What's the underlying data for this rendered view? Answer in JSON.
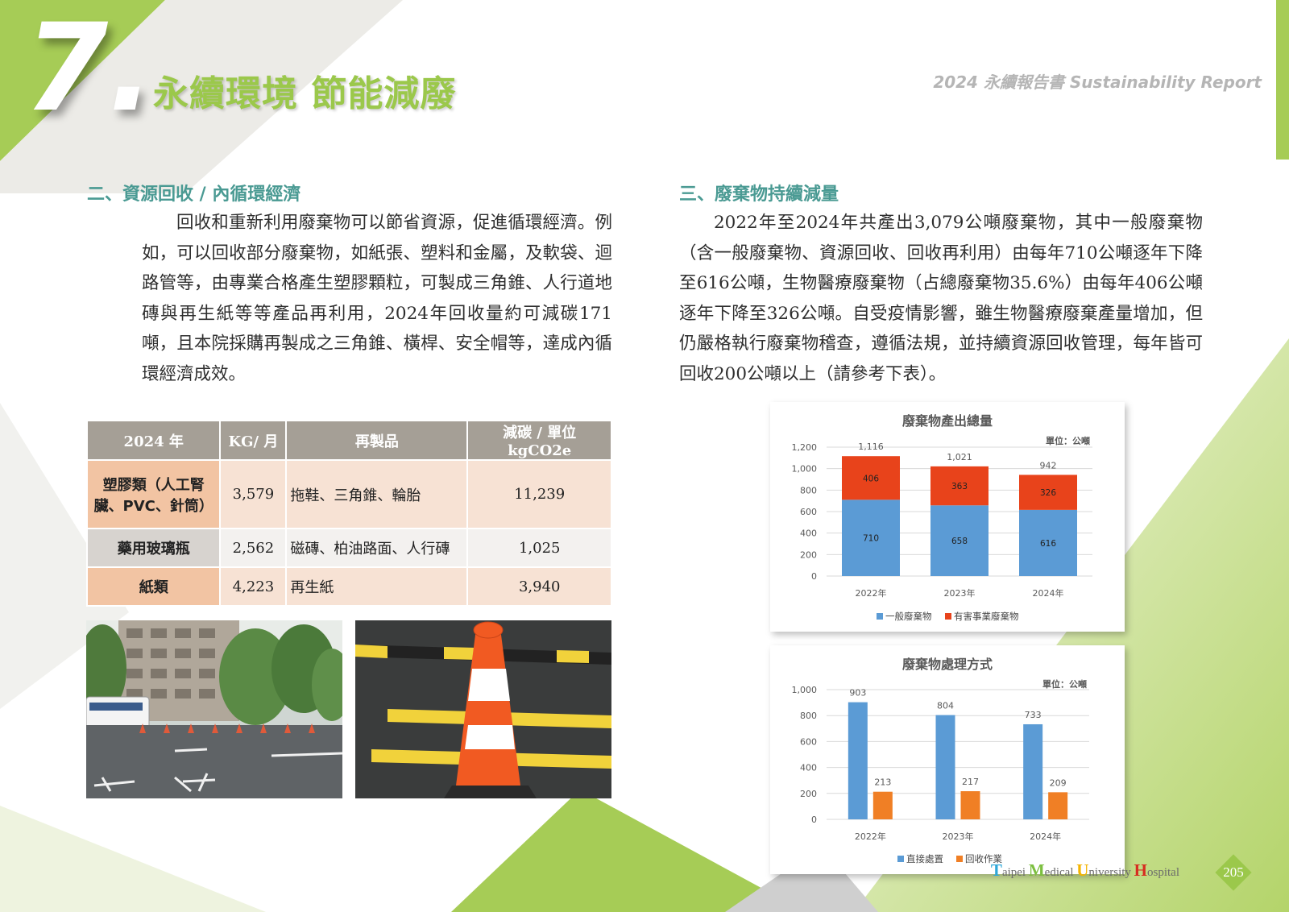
{
  "header": {
    "chapter_number": "7.",
    "chapter_title": "永續環境 節能減廢",
    "report_tag": "2024 永續報告書 Sustainability Report"
  },
  "left_section": {
    "heading": "二、資源回收 / 內循環經濟",
    "paragraph": "回收和重新利用廢棄物可以節省資源，促進循環經濟。例如，可以回收部分廢棄物，如紙張、塑料和金屬，及軟袋、迴路管等，由專業合格產生塑膠顆粒，可製成三角錐、人行道地磚與再生紙等等產品再利用，2024年回收量約可減碳171噸，且本院採購再製成之三角錐、橫桿、安全帽等，達成內循環經濟成效。"
  },
  "table": {
    "headers": [
      "2024 年",
      "KG/ 月",
      "再製品",
      "減碳 / 單位 kgCO2e"
    ],
    "rows": [
      {
        "category": "塑膠類（人工腎臟、PVC、針筒）",
        "kg": "3,579",
        "product": "拖鞋、三角錐、輪胎",
        "reduction": "11,239"
      },
      {
        "category": "藥用玻璃瓶",
        "kg": "2,562",
        "product": "磁磚、柏油路面、人行磚",
        "reduction": "1,025"
      },
      {
        "category": "紙類",
        "kg": "4,223",
        "product": "再生紙",
        "reduction": "3,940"
      }
    ]
  },
  "right_section": {
    "heading": "三、廢棄物持續減量",
    "paragraph": "2022年至2024年共產出3,079公噸廢棄物，其中一般廢棄物（含一般廢棄物、資源回收、回收再利用）由每年710公噸逐年下降至616公噸，生物醫療廢棄物（占總廢棄物35.6%）由每年406公噸逐年下降至326公噸。自受疫情影響，雖生物醫療廢棄產量增加，但仍嚴格執行廢棄物稽查，遵循法規，並持續資源回收管理，每年皆可回收200公噸以上（請參考下表）。"
  },
  "chart_data": [
    {
      "type": "bar",
      "stacked": true,
      "title": "廢棄物產出總量",
      "unit_label": "單位：公噸",
      "categories": [
        "2022年",
        "2023年",
        "2024年"
      ],
      "series": [
        {
          "name": "一般廢棄物",
          "values": [
            710,
            658,
            616
          ],
          "color": "#5b9bd5"
        },
        {
          "name": "有害事業廢棄物",
          "values": [
            406,
            363,
            326
          ],
          "color": "#e8431b"
        }
      ],
      "totals": [
        1116,
        1021,
        942
      ],
      "total_labels": [
        "1,116",
        "1,021",
        "942"
      ],
      "ylim": [
        0,
        1200
      ],
      "yticks": [
        0,
        200,
        400,
        600,
        800,
        1000,
        1200
      ],
      "ytick_labels": [
        "0",
        "200",
        "400",
        "600",
        "800",
        "1,000",
        "1,200"
      ],
      "legend": "bottom",
      "grid": true
    },
    {
      "type": "bar",
      "stacked": false,
      "title": "廢棄物處理方式",
      "unit_label": "單位：公噸",
      "categories": [
        "2022年",
        "2023年",
        "2024年"
      ],
      "series": [
        {
          "name": "直接處置",
          "values": [
            903,
            804,
            733
          ],
          "color": "#5b9bd5"
        },
        {
          "name": "回收作業",
          "values": [
            213,
            217,
            209
          ],
          "color": "#f07f25"
        }
      ],
      "ylim": [
        0,
        1000
      ],
      "yticks": [
        0,
        200,
        400,
        600,
        800,
        1000
      ],
      "ytick_labels": [
        "0",
        "200",
        "400",
        "600",
        "800",
        "1,000"
      ],
      "legend": "bottom",
      "grid": true
    }
  ],
  "footer": {
    "hospital_caps": [
      "T",
      "M",
      "U",
      "H"
    ],
    "hospital_rest": [
      "aipei ",
      "edical ",
      "niversity ",
      "ospital"
    ],
    "cap_colors": [
      "#2ea7d8",
      "#7cbf3f",
      "#f4b400",
      "#d62d20"
    ],
    "page_number": "205"
  },
  "photos": [
    {
      "label": "traffic cones on road"
    },
    {
      "label": "recycled orange traffic cone"
    }
  ]
}
